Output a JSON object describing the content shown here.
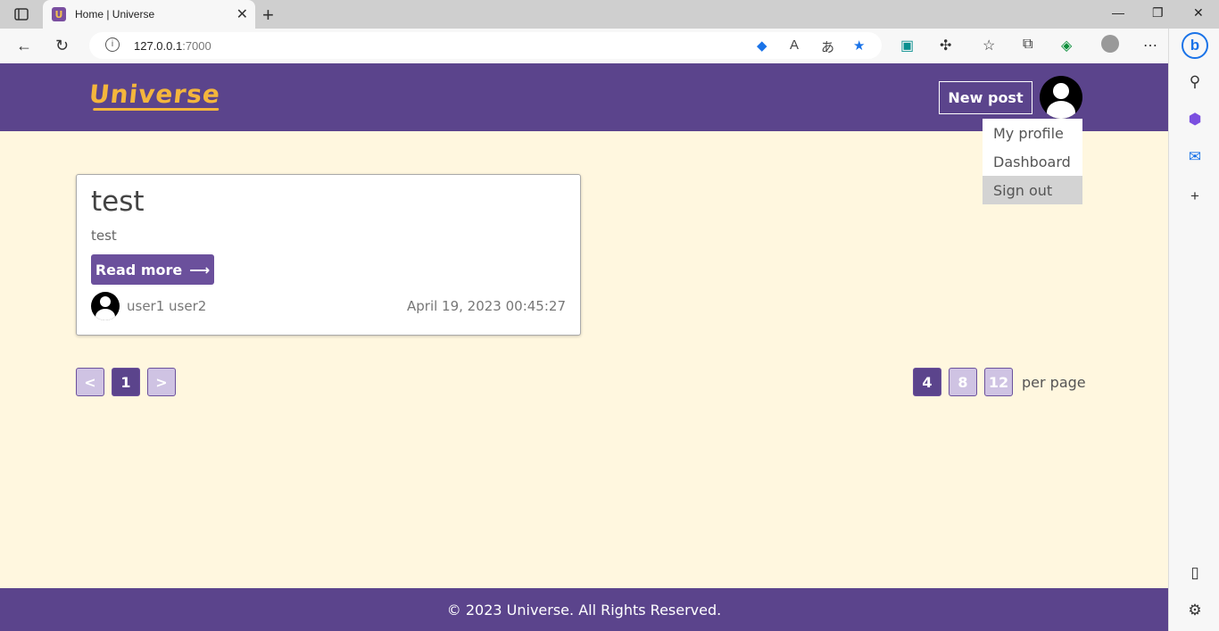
{
  "browser": {
    "tab_title": "Home | Universe",
    "favicon_letter": "U",
    "url_host": "127.0.0.1",
    "url_port": ":7000"
  },
  "site": {
    "logo": "Universe",
    "new_post_label": "New post",
    "menu": {
      "items": [
        {
          "label": "My profile"
        },
        {
          "label": "Dashboard"
        },
        {
          "label": "Sign out"
        }
      ]
    }
  },
  "post": {
    "title": "test",
    "body": "test",
    "read_more_label": "Read more",
    "read_more_arrow": "⟶",
    "author": "user1 user2",
    "date": "April 19, 2023 00:45:27"
  },
  "pagination": {
    "prev": "<",
    "current": "1",
    "next": ">"
  },
  "per_page": {
    "options": [
      "4",
      "8",
      "12"
    ],
    "selected": "4",
    "label": "per page"
  },
  "footer": {
    "text": "© 2023 Universe. All Rights Reserved."
  },
  "colors": {
    "brand": "#5b448c",
    "accent": "#f4b63c",
    "page_bg": "#fff7df"
  }
}
